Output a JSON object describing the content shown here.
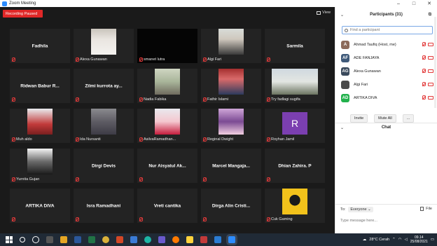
{
  "window": {
    "title": "Zoom Meeting"
  },
  "toolbar": {
    "recording_label": "Recording Paused",
    "view_label": "View"
  },
  "tiles": [
    {
      "name": "Fadhila",
      "label": "",
      "photo": "none"
    },
    {
      "name": "",
      "label": "Alexa Gunawan",
      "photo": "person-white-hijab"
    },
    {
      "name": "",
      "label": "smanet lutra",
      "photo": "black"
    },
    {
      "name": "",
      "label": "Algi Fari",
      "photo": "person-mask"
    },
    {
      "name": "Sarmila",
      "label": "",
      "photo": "none"
    },
    {
      "name": "Ridwan Babur R...",
      "label": "",
      "photo": "none"
    },
    {
      "name": "Zilmi kurrota ay...",
      "label": "",
      "photo": "none"
    },
    {
      "name": "",
      "label": "Nadia Fabika",
      "photo": "person-outdoor"
    },
    {
      "name": "",
      "label": "Fathir Islami",
      "photo": "anime-avatar"
    },
    {
      "name": "",
      "label": "Try fadlagi sugifa",
      "photo": "group-photo"
    },
    {
      "name": "",
      "label": "Muh aldo",
      "photo": "person-red"
    },
    {
      "name": "",
      "label": "Ida Nursanti",
      "photo": "person-hijab"
    },
    {
      "name": "",
      "label": "AsilvaRamadhan...",
      "photo": "person-pink-hijab"
    },
    {
      "name": "",
      "label": "Reginal Dwight",
      "photo": "anime-girl"
    },
    {
      "name": "",
      "label": "Royhan Jamil",
      "photo": "avatar-r"
    },
    {
      "name": "",
      "label": "Yurnita Gujan",
      "photo": "person-bw"
    },
    {
      "name": "Dirgi Devis",
      "label": "",
      "photo": "none"
    },
    {
      "name": "Nur Aisyatul Ak...",
      "label": "",
      "photo": "none"
    },
    {
      "name": "Marcel  Mangaja...",
      "label": "",
      "photo": "none"
    },
    {
      "name": "Dhian Zahira. P",
      "label": "",
      "photo": "none"
    },
    {
      "name": "ARTIKA DIVA",
      "label": "",
      "photo": "none"
    },
    {
      "name": "Isra Ramadhani",
      "label": "",
      "photo": "none"
    },
    {
      "name": "Vreti cantika",
      "label": "",
      "photo": "none"
    },
    {
      "name": "Dirga Alin Cristi...",
      "label": "",
      "photo": "none"
    },
    {
      "name": "",
      "label": "Cuk Gaming",
      "photo": "logo-yellow"
    }
  ],
  "avatar_r_letter": "R",
  "panel": {
    "participants_title": "Participants (31)",
    "search_placeholder": "Find a participant",
    "participants": [
      {
        "initials": "A",
        "name": "Ahmad Taufiq (Host, me)",
        "color": "#8c6a5a"
      },
      {
        "initials": "AF",
        "name": "ADE FANJAYA",
        "color": "#3f5a7a"
      },
      {
        "initials": "AG",
        "name": "Alexa Gunawan",
        "color": "#3a4a5c"
      },
      {
        "initials": "",
        "name": "Algi Fari",
        "color": "#4a4a4a"
      },
      {
        "initials": "AD",
        "name": "ARTIKA DIVA",
        "color": "#22b14c"
      }
    ],
    "invite_label": "Invite",
    "mute_all_label": "Mute All",
    "more_label": "...",
    "chat_title": "Chat",
    "to_label": "To:",
    "to_value": "Everyone",
    "file_label": "File",
    "message_placeholder": "Type message here..."
  },
  "taskbar": {
    "weather": "28°C  Cerah",
    "time": "09.14",
    "date": "25/08/2021"
  }
}
